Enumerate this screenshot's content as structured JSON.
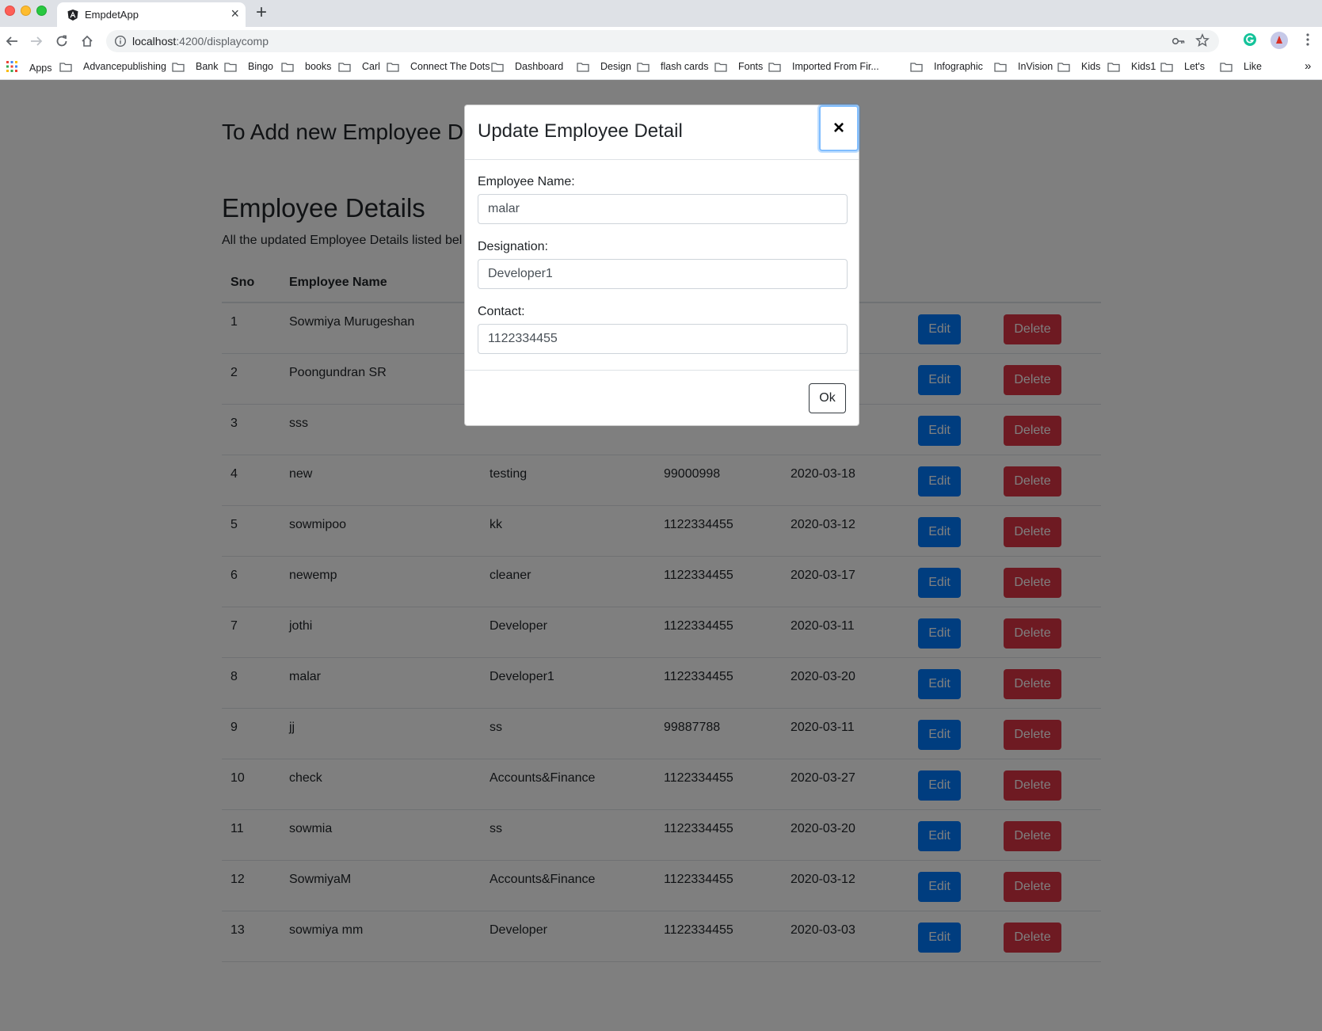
{
  "browser": {
    "tab_title": "EmpdetApp",
    "url_host": "localhost",
    "url_path": ":4200/displaycomp",
    "bookmarks": [
      {
        "label": "Apps"
      },
      {
        "label": "Advancepublishing"
      },
      {
        "label": "Bank"
      },
      {
        "label": "Bingo"
      },
      {
        "label": "books"
      },
      {
        "label": "Carl"
      },
      {
        "label": "Connect The Dots"
      },
      {
        "label": "Dashboard"
      },
      {
        "label": "Design"
      },
      {
        "label": "flash cards"
      },
      {
        "label": "Fonts"
      },
      {
        "label": "Imported From Fir..."
      },
      {
        "label": "Infographic"
      },
      {
        "label": "InVision"
      },
      {
        "label": "Kids"
      },
      {
        "label": "Kids1"
      },
      {
        "label": "Let's"
      },
      {
        "label": "Like"
      }
    ]
  },
  "page": {
    "add_title": "To Add new Employee D",
    "section_title": "Employee Details",
    "section_sub": "All the updated Employee Details listed bel",
    "table": {
      "headers": {
        "sno": "Sno",
        "name": "Employee Name"
      },
      "edit_label": "Edit",
      "delete_label": "Delete",
      "rows": [
        {
          "sno": "1",
          "name": "Sowmiya Murugeshan",
          "designation": "",
          "contact": "",
          "date": ""
        },
        {
          "sno": "2",
          "name": "Poongundran SR",
          "designation": "",
          "contact": "",
          "date": ""
        },
        {
          "sno": "3",
          "name": "sss",
          "designation": "",
          "contact": "",
          "date": ""
        },
        {
          "sno": "4",
          "name": "new",
          "designation": "testing",
          "contact": "99000998",
          "date": "2020-03-18"
        },
        {
          "sno": "5",
          "name": "sowmipoo",
          "designation": "kk",
          "contact": "1122334455",
          "date": "2020-03-12"
        },
        {
          "sno": "6",
          "name": "newemp",
          "designation": "cleaner",
          "contact": "1122334455",
          "date": "2020-03-17"
        },
        {
          "sno": "7",
          "name": "jothi",
          "designation": "Developer",
          "contact": "1122334455",
          "date": "2020-03-11"
        },
        {
          "sno": "8",
          "name": "malar",
          "designation": "Developer1",
          "contact": "1122334455",
          "date": "2020-03-20"
        },
        {
          "sno": "9",
          "name": "jj",
          "designation": "ss",
          "contact": "99887788",
          "date": "2020-03-11"
        },
        {
          "sno": "10",
          "name": "check",
          "designation": "Accounts&Finance",
          "contact": "1122334455",
          "date": "2020-03-27"
        },
        {
          "sno": "11",
          "name": "sowmia",
          "designation": "ss",
          "contact": "1122334455",
          "date": "2020-03-20"
        },
        {
          "sno": "12",
          "name": "SowmiyaM",
          "designation": "Accounts&Finance",
          "contact": "1122334455",
          "date": "2020-03-12"
        },
        {
          "sno": "13",
          "name": "sowmiya mm",
          "designation": "Developer",
          "contact": "1122334455",
          "date": "2020-03-03"
        }
      ]
    }
  },
  "modal": {
    "title": "Update Employee Detail",
    "close_glyph": "×",
    "fields": {
      "name_label": "Employee Name:",
      "name_value": "malar",
      "designation_label": "Designation:",
      "designation_value": "Developer1",
      "contact_label": "Contact:",
      "contact_value": "1122334455"
    },
    "ok_label": "Ok"
  },
  "colors": {
    "primary": "#007bff",
    "danger": "#dc3545",
    "backdrop": "rgba(0,0,0,0.5)"
  }
}
